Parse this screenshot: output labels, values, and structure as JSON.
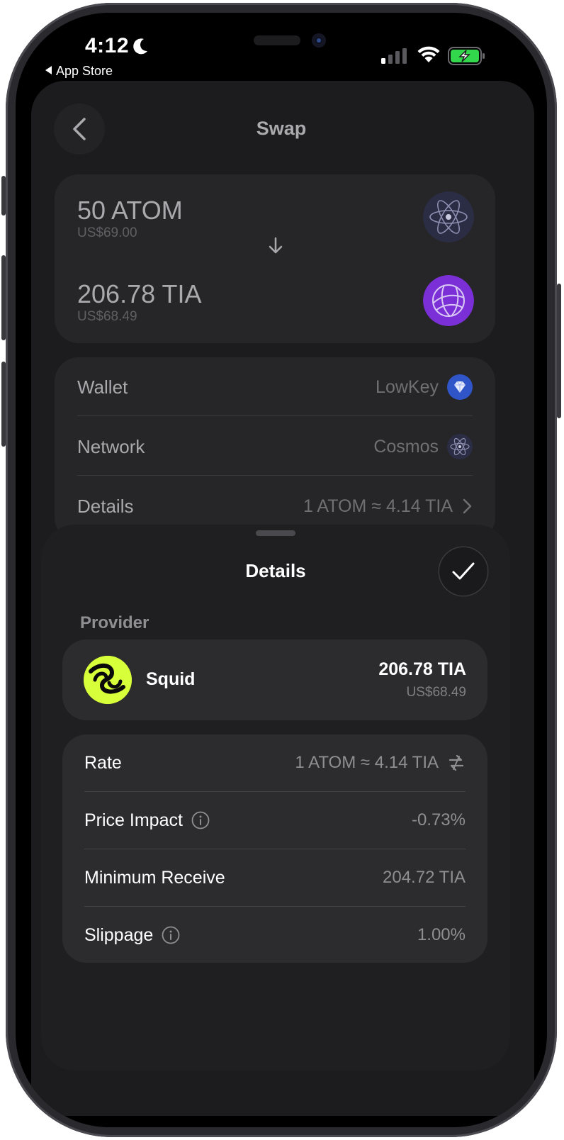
{
  "status_bar": {
    "time": "4:12",
    "back_app": "App Store"
  },
  "header": {
    "title": "Swap"
  },
  "swap": {
    "from": {
      "amount": "50 ATOM",
      "fiat": "US$69.00",
      "logo": "cosmos-atom-icon"
    },
    "to": {
      "amount": "206.78 TIA",
      "fiat": "US$68.49",
      "logo": "celestia-tia-icon"
    }
  },
  "info": {
    "wallet_label": "Wallet",
    "wallet_value": "LowKey",
    "network_label": "Network",
    "network_value": "Cosmos",
    "details_label": "Details",
    "details_value": "1 ATOM ≈ 4.14 TIA"
  },
  "sheet": {
    "title": "Details",
    "provider_section": "Provider",
    "provider": {
      "name": "Squid",
      "amount": "206.78 TIA",
      "fiat": "US$68.49"
    },
    "rows": {
      "rate_label": "Rate",
      "rate_value": "1 ATOM ≈ 4.14 TIA",
      "price_impact_label": "Price Impact",
      "price_impact_value": "-0.73%",
      "min_receive_label": "Minimum Receive",
      "min_receive_value": "204.72 TIA",
      "slippage_label": "Slippage",
      "slippage_value": "1.00%"
    }
  },
  "colors": {
    "background": "#1c1c1e",
    "card": "#262628",
    "sheet": "#1f1f21",
    "tia_purple": "#7b2fd6",
    "squid_lime": "#d7ff3a",
    "wallet_blue": "#2f55c8",
    "battery_green": "#32d74b"
  }
}
